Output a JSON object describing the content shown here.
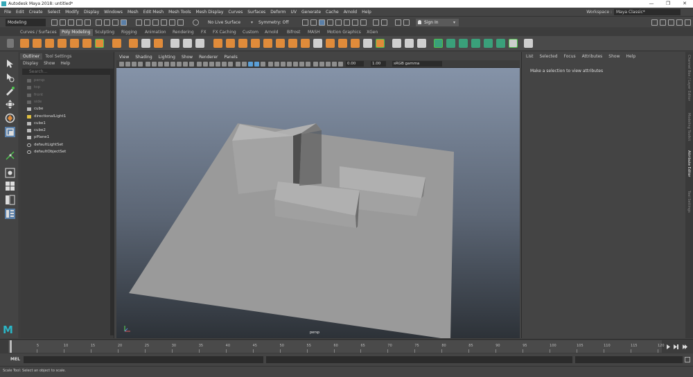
{
  "title_bar": {
    "text": "Autodesk Maya 2018: untitled*"
  },
  "menus": [
    "File",
    "Edit",
    "Create",
    "Select",
    "Modify",
    "Display",
    "Windows",
    "Mesh",
    "Edit Mesh",
    "Mesh Tools",
    "Mesh Display",
    "Curves",
    "Surfaces",
    "Deform",
    "UV",
    "Generate",
    "Cache",
    "Arnold",
    "Help"
  ],
  "workspace": {
    "label": "Workspace :",
    "value": "Maya Classic*"
  },
  "status_line": {
    "mode": "Modeling",
    "live_surface": "No Live Surface",
    "symmetry": "Symmetry: Off",
    "sign_in": "Sign In"
  },
  "shelf_tabs": [
    "Curves / Surfaces",
    "Poly Modeling",
    "Sculpting",
    "Rigging",
    "Animation",
    "Rendering",
    "FX",
    "FX Caching",
    "Custom",
    "Arnold",
    "Bifrost",
    "MASH",
    "Motion Graphics",
    "XGen"
  ],
  "active_shelf_tab": "Poly Modeling",
  "outliner": {
    "tabs": [
      "Outliner",
      "Tool Settings"
    ],
    "menu": [
      "Display",
      "Show",
      "Help"
    ],
    "search_placeholder": "Search...",
    "items": [
      {
        "label": "persp",
        "dim": true
      },
      {
        "label": "top",
        "dim": true
      },
      {
        "label": "front",
        "dim": true
      },
      {
        "label": "side",
        "dim": true
      },
      {
        "label": "cube",
        "dim": false
      },
      {
        "label": "directionalLight1",
        "dim": false
      },
      {
        "label": "cube1",
        "dim": false
      },
      {
        "label": "cube2",
        "dim": false
      },
      {
        "label": "pPlane1",
        "dim": false
      },
      {
        "label": "defaultLightSet",
        "dim": false
      },
      {
        "label": "defaultObjectSet",
        "dim": false
      }
    ]
  },
  "viewport": {
    "menu": [
      "View",
      "Shading",
      "Lighting",
      "Show",
      "Renderer",
      "Panels"
    ],
    "exposure": "0.00",
    "gamma": "1.00",
    "color_space": "sRGB gamma",
    "camera_label": "persp"
  },
  "attribute_editor": {
    "menu": [
      "List",
      "Selected",
      "Focus",
      "Attributes",
      "Show",
      "Help"
    ],
    "message": "Make a selection to view attributes"
  },
  "side_tabs": [
    "Channel Box / Layer Editor",
    "Modeling Toolkit",
    "Attribute Editor",
    "Tool Settings"
  ],
  "time_slider": {
    "ticks": [
      "1",
      "5",
      "10",
      "15",
      "20",
      "25",
      "30",
      "35",
      "40",
      "45",
      "50",
      "55",
      "60",
      "65",
      "70",
      "75",
      "80",
      "85",
      "90",
      "95",
      "100",
      "105",
      "110",
      "115",
      "120"
    ]
  },
  "command_line": {
    "label": "MEL"
  },
  "help_line": {
    "text": "Scale Tool: Select an object to scale."
  }
}
